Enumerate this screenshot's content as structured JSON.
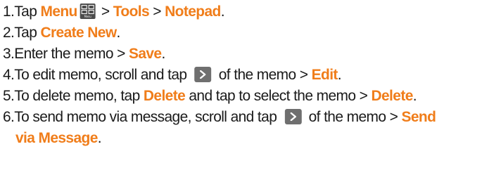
{
  "steps": [
    {
      "n": "1.",
      "t1": "Tap ",
      "k1": "Menu",
      "icon_label": "Menu",
      "t2": " > ",
      "k2": "Tools",
      "t3": " > ",
      "k3": "Notepad",
      "t4": "."
    },
    {
      "n": "2.",
      "t1": "Tap ",
      "k1": "Create New",
      "t2": "."
    },
    {
      "n": "3.",
      "t1": "Enter the memo > ",
      "k1": "Save",
      "t2": "."
    },
    {
      "n": "4.",
      "t1": "To edit memo, scroll and tap ",
      "t2": " of the memo > ",
      "k1": "Edit",
      "t3": "."
    },
    {
      "n": "5.",
      "t1": "To delete memo, tap ",
      "k1": "Delete",
      "t2": " and tap to select the memo > ",
      "k2": "Delete",
      "t3": "."
    },
    {
      "n": "6.",
      "t1": "To send memo via message, scroll and tap ",
      "t2": " of the memo > ",
      "k1": "Send",
      "k2": "via Message",
      "t3": "."
    }
  ],
  "colors": {
    "keyword": "#f07d1a",
    "text": "#1a1a1a",
    "icon_bg": "#6f6f6f"
  },
  "icons": [
    "menu-grid-icon",
    "chevron-right-icon"
  ]
}
